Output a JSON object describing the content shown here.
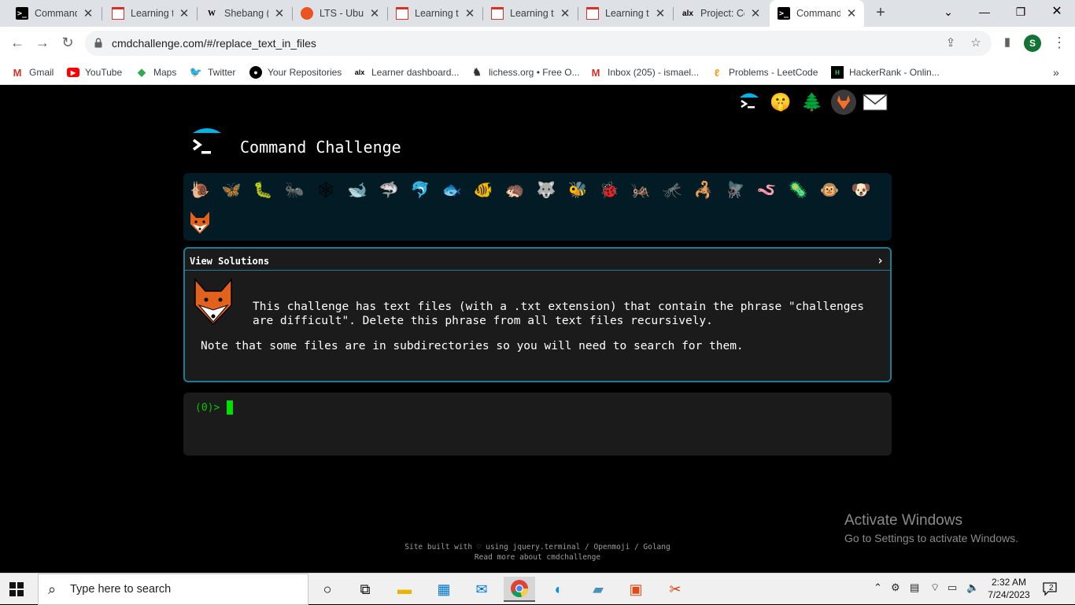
{
  "browser": {
    "tabs": [
      {
        "title": "Command",
        "icon": "terminal-icon",
        "active": false
      },
      {
        "title": "Learning th",
        "icon": "doc-icon",
        "active": false
      },
      {
        "title": "Shebang (",
        "icon": "wikipedia-icon",
        "active": false
      },
      {
        "title": "LTS - Ubun",
        "icon": "ubuntu-icon",
        "active": false
      },
      {
        "title": "Learning th",
        "icon": "doc-icon",
        "active": false
      },
      {
        "title": "Learning th",
        "icon": "doc-icon",
        "active": false
      },
      {
        "title": "Learning th",
        "icon": "doc-icon",
        "active": false
      },
      {
        "title": "Project: Co",
        "icon": "alx-icon",
        "active": false
      },
      {
        "title": "Command",
        "icon": "terminal-icon",
        "active": true
      }
    ],
    "new_tab": "+",
    "url": "cmdchallenge.com/#/replace_text_in_files",
    "profile_initial": "S",
    "bookmarks": [
      {
        "label": "Gmail",
        "icon": "gmail-icon"
      },
      {
        "label": "YouTube",
        "icon": "youtube-icon"
      },
      {
        "label": "Maps",
        "icon": "maps-icon"
      },
      {
        "label": "Twitter",
        "icon": "twitter-icon"
      },
      {
        "label": "Your Repositories",
        "icon": "github-icon"
      },
      {
        "label": "Learner dashboard...",
        "icon": "alx-icon"
      },
      {
        "label": "lichess.org • Free O...",
        "icon": "lichess-icon"
      },
      {
        "label": "Inbox (205) - ismael...",
        "icon": "gmail-icon"
      },
      {
        "label": "Problems - LeetCode",
        "icon": "leetcode-icon"
      },
      {
        "label": "HackerRank - Onlin...",
        "icon": "hackerrank-icon"
      }
    ],
    "bookmarks_overflow": "»"
  },
  "page": {
    "title": "Command Challenge",
    "top_icons": [
      "terminal-hat-icon",
      "shush-face-icon",
      "tree-icon",
      "gitlab-icon",
      "mail-icon"
    ],
    "critters": [
      "snail-icon",
      "butterfly-icon",
      "caterpillar-icon",
      "ant-icon",
      "spider-web-icon",
      "whale-icon",
      "shark-icon",
      "dolphin-icon",
      "fish-icon",
      "tropical-fish-icon",
      "hedgehog-icon",
      "wolf-icon",
      "bee-icon",
      "ladybug-icon",
      "cricket-icon",
      "mosquito-icon",
      "scorpion-icon",
      "fly-icon",
      "worm-icon",
      "microbe-icon",
      "monkey-icon",
      "dog-icon",
      "fox-icon"
    ],
    "solutions_label": "View Solutions",
    "solutions_chevron": "›",
    "challenge_description": "This challenge has text files (with a .txt extension) that contain the phrase \"challenges are difficult\". Delete this phrase from all text files recursively.",
    "challenge_note": "Note that some files are in subdirectories so you will need to search for them.",
    "prompt": "(0)>",
    "footer_line1": "Site built with ♡ using jquery.terminal / Openmoji / Golang",
    "footer_line2": "Read more about cmdchallenge",
    "activate_title": "Activate Windows",
    "activate_sub": "Go to Settings to activate Windows."
  },
  "taskbar": {
    "search_placeholder": "Type here to search",
    "time": "2:32 AM",
    "date": "7/24/2023",
    "notifications": "2"
  },
  "colors": {
    "accent": "#1a7f92",
    "critter_bar": "#021b24",
    "prompt_green": "#00c800"
  }
}
